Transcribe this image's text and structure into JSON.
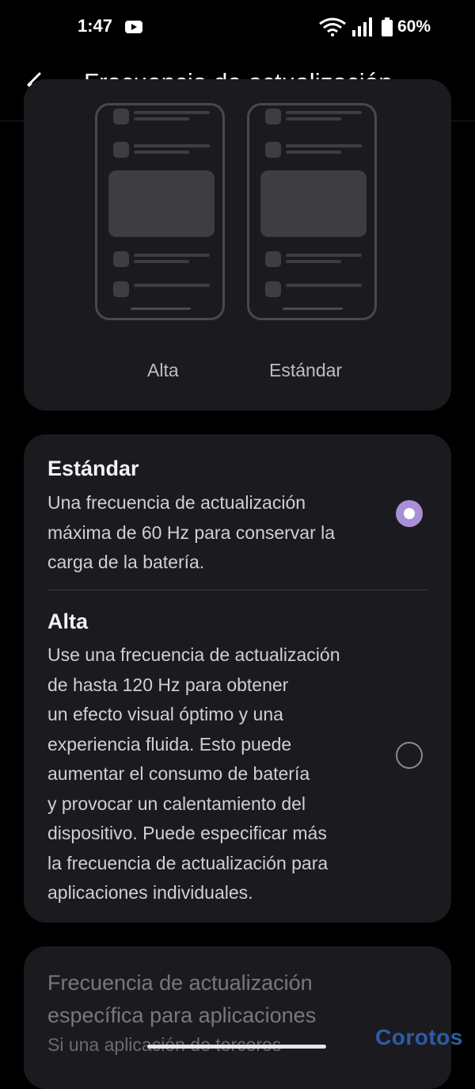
{
  "status_bar": {
    "time": "1:47",
    "battery": "60%"
  },
  "app_bar": {
    "title": "Frecuencia de actualización ..."
  },
  "preview": {
    "labels": {
      "alta": "Alta",
      "estandar": "Estándar"
    }
  },
  "options": [
    {
      "title": "Estándar",
      "description_lines": [
        "Una frecuencia de actualización",
        "máxima de 60 Hz para conservar la",
        "carga de la batería."
      ],
      "selected": true
    },
    {
      "title": "Alta",
      "description_lines": [
        "Use una frecuencia de actualización",
        "de hasta 120 Hz para obtener",
        "un efecto visual óptimo y una",
        "experiencia fluida. Esto puede",
        "aumentar el consumo de batería",
        "y provocar un calentamiento del",
        "dispositivo. Puede especificar más",
        "la frecuencia de actualización para",
        "aplicaciones individuales."
      ],
      "selected": false
    }
  ],
  "app_specific": {
    "title_lines": [
      "Frecuencia de actualización",
      "específica para aplicaciones"
    ],
    "description": "Si una aplicación de terceros"
  },
  "watermark": "Corotos",
  "colors": {
    "accent": "#a98fd6",
    "card": "#1b1b1f",
    "background": "#000000"
  }
}
